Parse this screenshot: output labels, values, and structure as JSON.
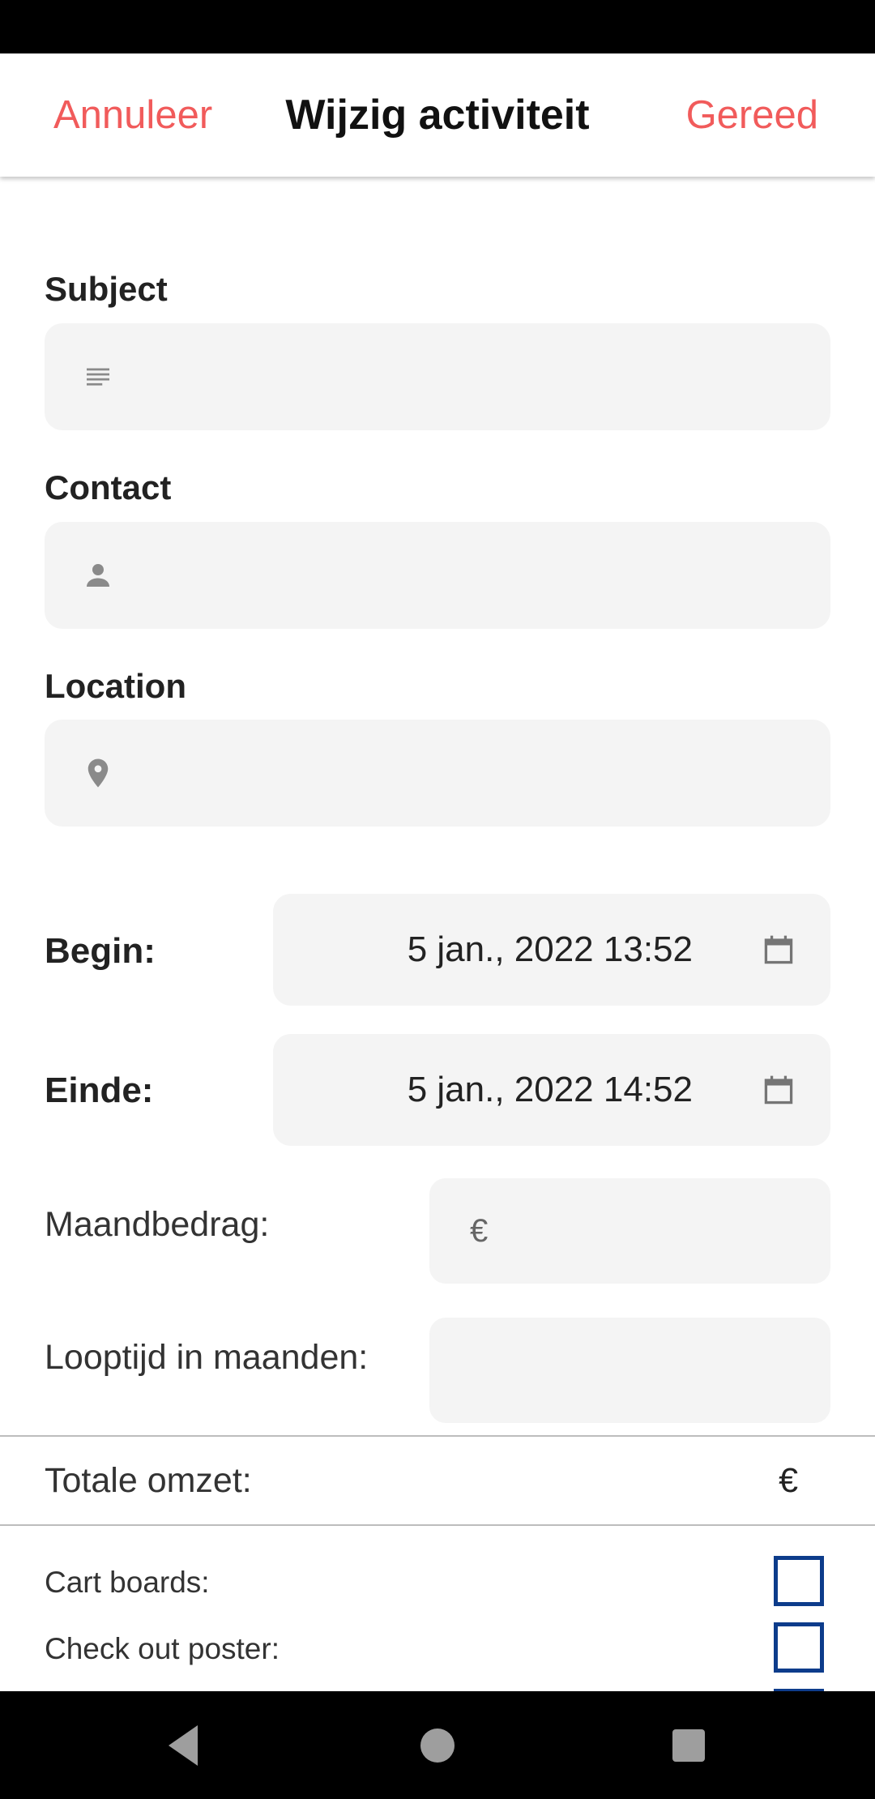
{
  "header": {
    "cancel_label": "Annuleer",
    "title": "Wijzig activiteit",
    "done_label": "Gereed"
  },
  "fields": {
    "subject": {
      "label": "Subject",
      "value": "",
      "icon": "notes-icon"
    },
    "contact": {
      "label": "Contact",
      "value": "",
      "icon": "person-icon"
    },
    "location": {
      "label": "Location",
      "value": "",
      "icon": "location-pin-icon"
    }
  },
  "schedule": {
    "begin": {
      "label": "Begin:",
      "value": "5 jan., 2022 13:52",
      "icon": "calendar-icon"
    },
    "end": {
      "label": "Einde:",
      "value": "5 jan., 2022 14:52",
      "icon": "calendar-icon"
    }
  },
  "finance": {
    "monthly_amount": {
      "label": "Maandbedrag:",
      "prefix": "€",
      "value": ""
    },
    "duration": {
      "label": "Looptijd in maanden:",
      "value": ""
    },
    "total": {
      "label": "Totale omzet:",
      "value": "€"
    }
  },
  "options": [
    {
      "label": "Cart boards:",
      "checked": false
    },
    {
      "label": "Check out poster:",
      "checked": false
    }
  ],
  "colors": {
    "accent": "#f15b5b",
    "checkbox_border": "#0d3c8b",
    "input_background": "#f4f4f4"
  },
  "navigation": {
    "back": "back-icon",
    "home": "home-icon",
    "recents": "recents-icon"
  }
}
